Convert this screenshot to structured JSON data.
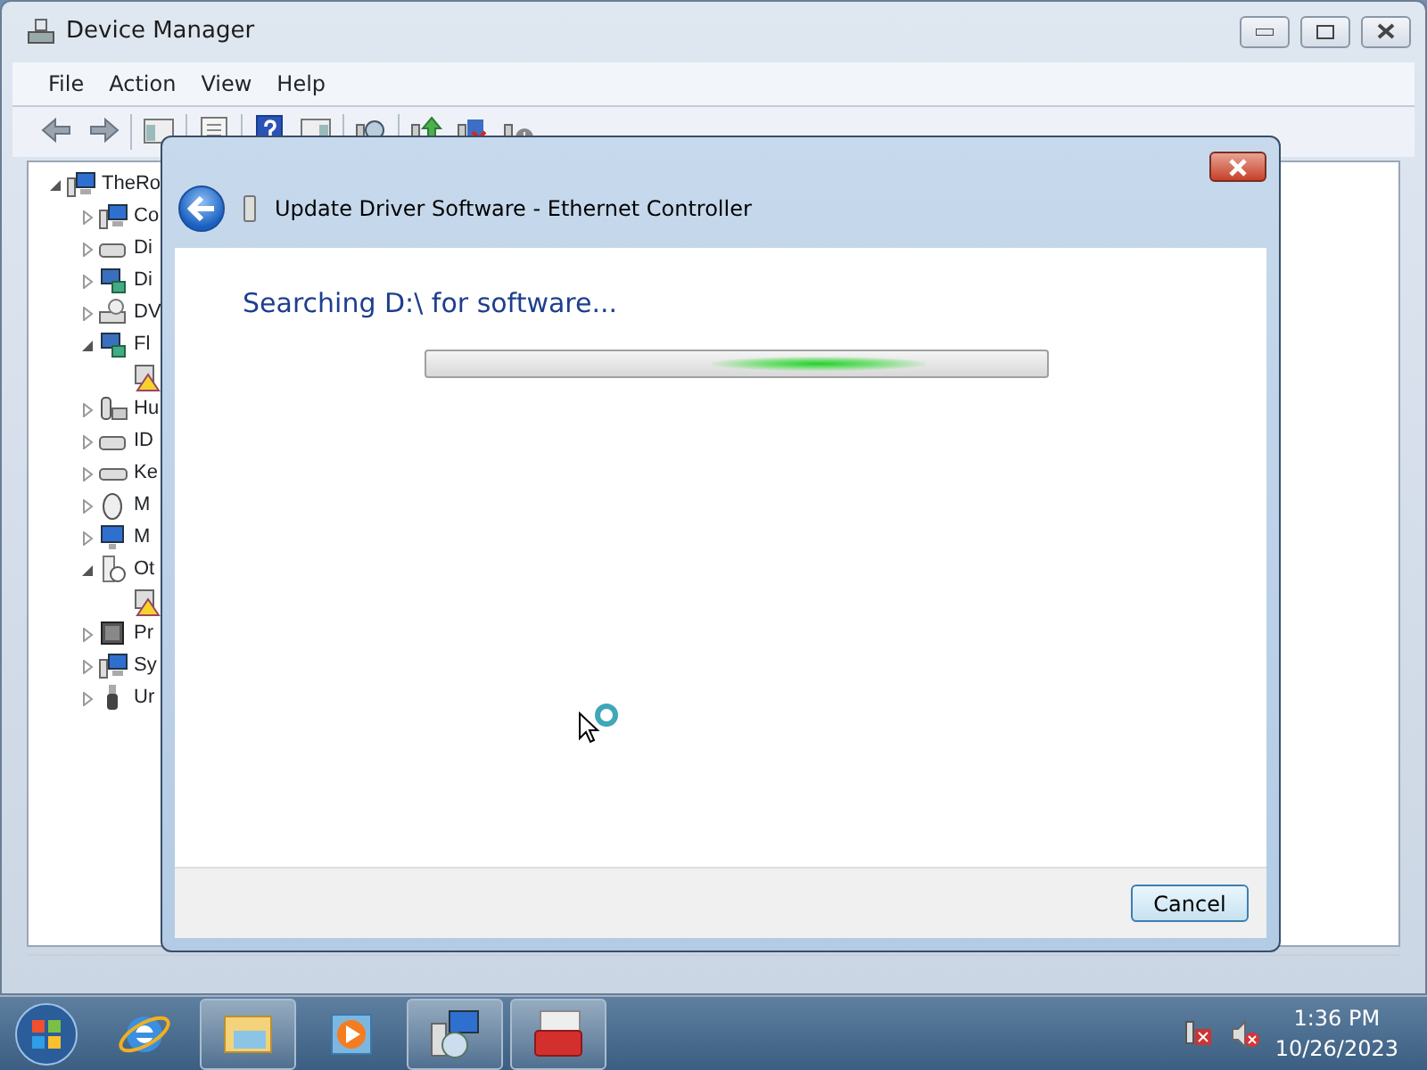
{
  "window": {
    "title": "Device Manager"
  },
  "menu": [
    "File",
    "Action",
    "View",
    "Help"
  ],
  "tree": [
    {
      "label": "TheRo",
      "kind": "computer",
      "expanded": true,
      "children": [
        {
          "label": "Co",
          "kind": "computer",
          "expanded": false
        },
        {
          "label": "Di",
          "kind": "drive",
          "expanded": false
        },
        {
          "label": "Di",
          "kind": "display",
          "expanded": false
        },
        {
          "label": "DV",
          "kind": "disc",
          "expanded": false
        },
        {
          "label": "Fl",
          "kind": "display",
          "expanded": true,
          "children": [
            {
              "kind": "warning"
            }
          ]
        },
        {
          "label": "Hu",
          "kind": "hid",
          "expanded": false
        },
        {
          "label": "ID",
          "kind": "drive",
          "expanded": false
        },
        {
          "label": "Ke",
          "kind": "keyboard",
          "expanded": false
        },
        {
          "label": "M",
          "kind": "mouse",
          "expanded": false
        },
        {
          "label": "M",
          "kind": "monitor",
          "expanded": false
        },
        {
          "label": "Ot",
          "kind": "unknown",
          "expanded": true,
          "children": [
            {
              "kind": "warning"
            }
          ]
        },
        {
          "label": "Pr",
          "kind": "chip",
          "expanded": false
        },
        {
          "label": "Sy",
          "kind": "computer",
          "expanded": false
        },
        {
          "label": "Ur",
          "kind": "usb",
          "expanded": false
        }
      ]
    }
  ],
  "dialog": {
    "title": "Update Driver Software - Ethernet Controller",
    "heading": "Searching D:\\ for software...",
    "buttons": [
      "Cancel"
    ]
  },
  "taskbar": {
    "items": [
      {
        "kind": "ie",
        "running": false
      },
      {
        "kind": "explorer",
        "running": true
      },
      {
        "kind": "media",
        "running": false
      },
      {
        "kind": "installer",
        "running": true
      },
      {
        "kind": "toolbox",
        "running": true
      }
    ],
    "time": "1:36 PM",
    "date": "10/26/2023"
  }
}
